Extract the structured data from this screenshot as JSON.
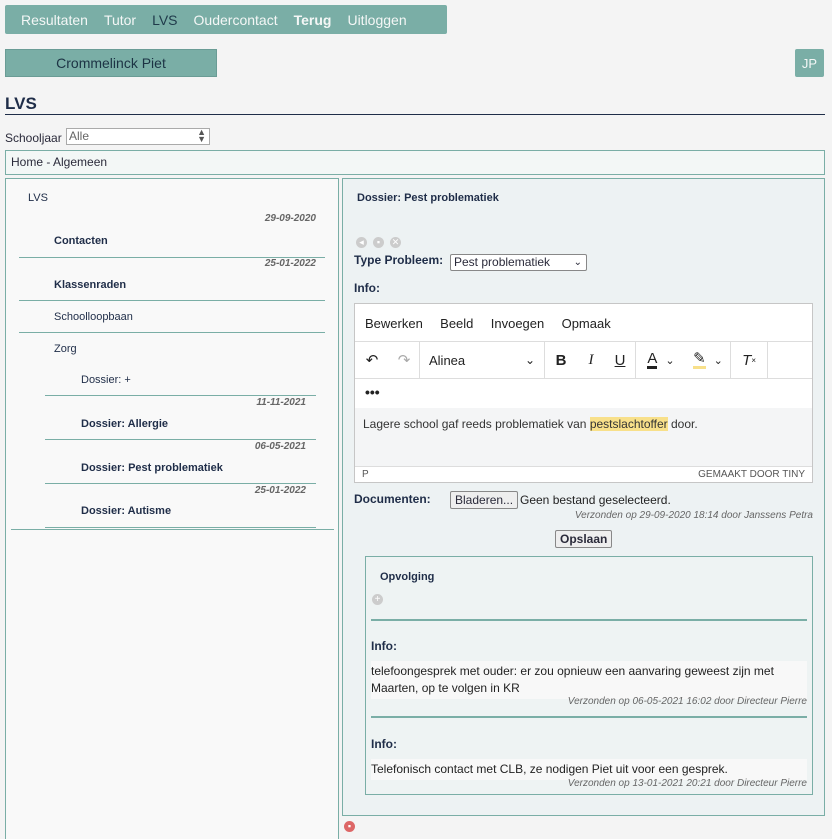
{
  "nav": [
    "Resultaten",
    "Tutor",
    "LVS",
    "Oudercontact",
    "Terug",
    "Uitloggen"
  ],
  "user": {
    "name": "Crommelinck Piet",
    "initials": "JP"
  },
  "page": {
    "title": "LVS"
  },
  "schooljaar": {
    "label": "Schooljaar",
    "value": "Alle"
  },
  "breadcrumb": "Home - Algemeen",
  "tree": {
    "root": "LVS",
    "contacten_date": "29-09-2020",
    "contacten": "Contacten",
    "klassenraden_date": "25-01-2022",
    "klassenraden": "Klassenraden",
    "schoolloopbaan": "Schoolloopbaan",
    "zorg": "Zorg",
    "dossier_new": "Dossier: +",
    "allergie_date": "11-11-2021",
    "allergie": "Dossier: Allergie",
    "pest_date": "06-05-2021",
    "pest": "Dossier: Pest problematiek",
    "autisme_date": "25-01-2022",
    "autisme": "Dossier: Autisme"
  },
  "dossier": {
    "header": "Dossier: Pest problematiek",
    "type_label": "Type Probleem:",
    "type_value": "Pest problematiek",
    "info_label": "Info:",
    "editor": {
      "menu": [
        "Bewerken",
        "Beeld",
        "Invoegen",
        "Opmaak"
      ],
      "format": "Alinea",
      "text_before": "Lagere school gaf reeds problematiek van ",
      "text_highlight": "pestslachtoffer",
      "text_after": " door.",
      "status_left": "P",
      "status_right": "GEMAAKT DOOR TINY"
    },
    "documents_label": "Documenten:",
    "browse_button": "Bladeren...",
    "no_file": "Geen bestand geselecteerd.",
    "sent": "Verzonden op 29-09-2020 18:14 door Janssens Petra",
    "save_button": "Opslaan"
  },
  "opvolging": {
    "title": "Opvolging",
    "notes": [
      {
        "label": "Info:",
        "text": "telefoongesprek met ouder: er zou opnieuw een aanvaring geweest zijn met Maarten, op te volgen in KR",
        "sent": "Verzonden op 06-05-2021 16:02 door Directeur Pierre"
      },
      {
        "label": "Info:",
        "text": "Telefonisch contact met CLB, ze nodigen Piet uit voor een gesprek.",
        "sent": "Verzonden op 13-01-2021 20:21 door Directeur Pierre"
      }
    ]
  },
  "colors": {
    "accent": "#7aaea6",
    "title": "#1f2d48",
    "highlight": "#f8e08a"
  }
}
